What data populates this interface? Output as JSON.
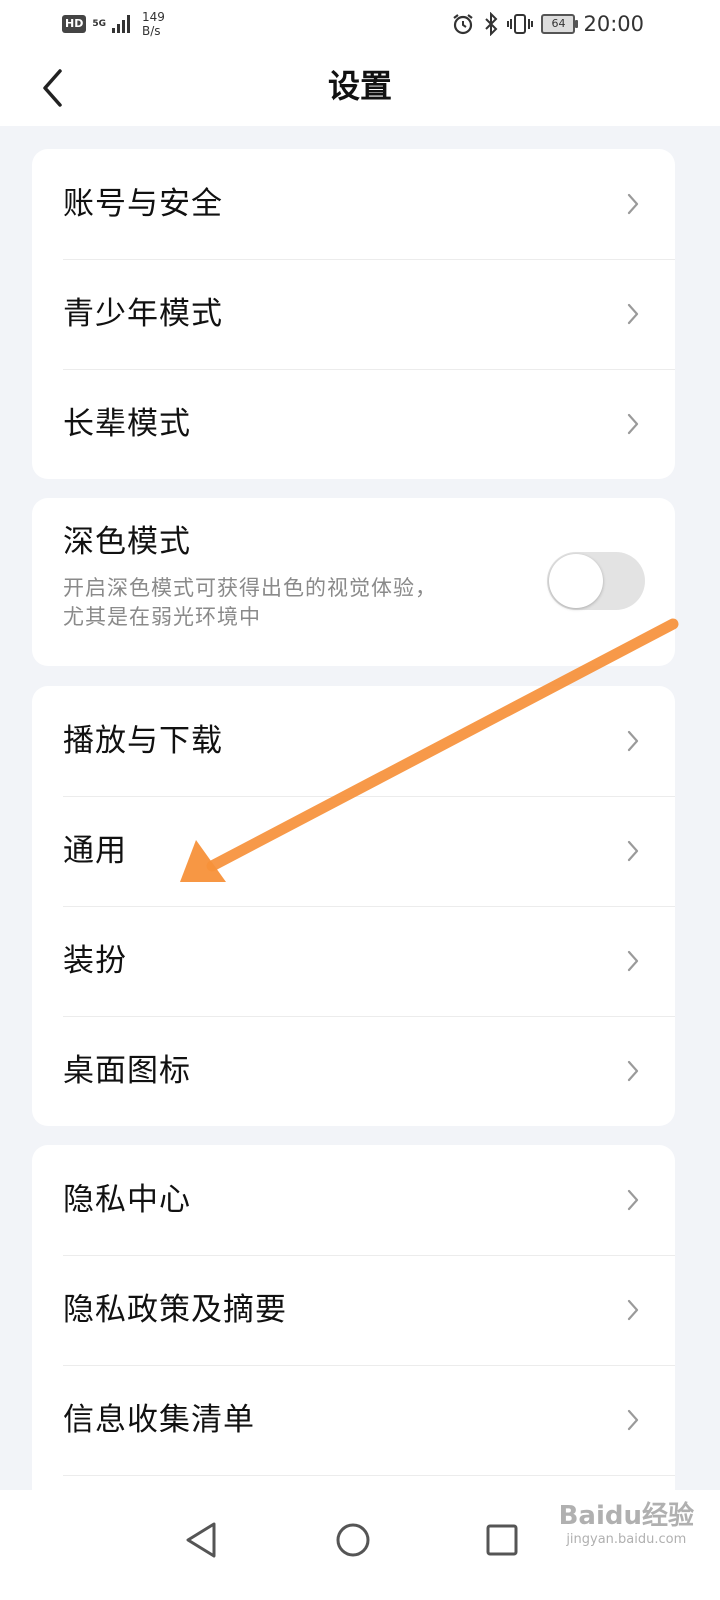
{
  "status_bar": {
    "hd": "HD",
    "network": "5G",
    "speed_value": "149",
    "speed_unit": "B/s",
    "battery": "64",
    "time": "20:00"
  },
  "header": {
    "title": "设置",
    "back_icon": "chevron-left-icon"
  },
  "groups": {
    "account": [
      "账号与安全",
      "青少年模式",
      "长辈模式"
    ],
    "dark_mode": {
      "title": "深色模式",
      "description_line1": "开启深色模式可获得出色的视觉体验，",
      "description_line2": "尤其是在弱光环境中",
      "enabled": false
    },
    "general": [
      "播放与下载",
      "通用",
      "装扮",
      "桌面图标"
    ],
    "privacy": [
      "隐私中心",
      "隐私政策及摘要",
      "信息收集清单"
    ]
  },
  "annotation": {
    "arrow_color": "#f7913a",
    "points_to": "通用"
  },
  "nav_bar": {
    "back_icon": "triangle-back-icon",
    "home_icon": "circle-home-icon",
    "recents_icon": "square-recents-icon"
  },
  "watermark": {
    "main": "Baidu经验",
    "sub": "jingyan.baidu.com"
  }
}
